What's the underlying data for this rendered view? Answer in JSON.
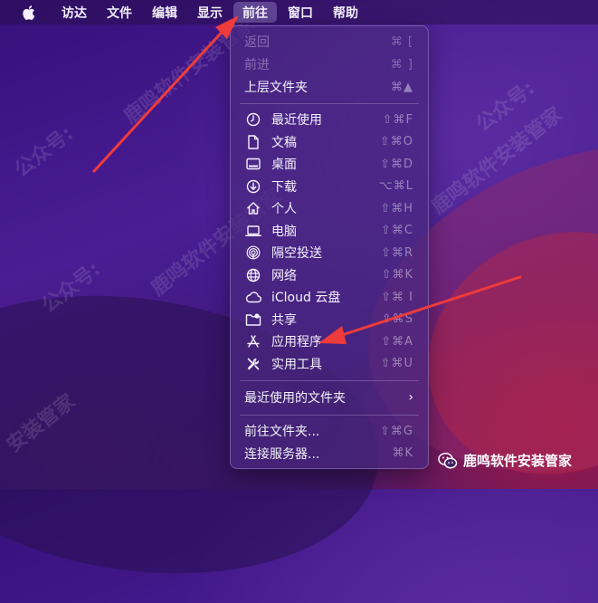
{
  "menubar": {
    "apple_icon": "apple-logo-icon",
    "items": [
      {
        "label": "访达"
      },
      {
        "label": "文件"
      },
      {
        "label": "编辑"
      },
      {
        "label": "显示"
      },
      {
        "label": "前往",
        "active": true
      },
      {
        "label": "窗口"
      },
      {
        "label": "帮助"
      }
    ]
  },
  "go_menu": {
    "top": [
      {
        "label": "返回",
        "shortcut": "⌘ [",
        "enabled": false
      },
      {
        "label": "前进",
        "shortcut": "⌘ ]",
        "enabled": false
      },
      {
        "label": "上层文件夹",
        "shortcut": "⌘▲",
        "enabled": true
      }
    ],
    "places": [
      {
        "label": "最近使用",
        "shortcut": "⇧⌘F",
        "icon": "clock-icon"
      },
      {
        "label": "文稿",
        "shortcut": "⇧⌘O",
        "icon": "document-icon"
      },
      {
        "label": "桌面",
        "shortcut": "⇧⌘D",
        "icon": "desktop-icon"
      },
      {
        "label": "下载",
        "shortcut": "⌥⌘L",
        "icon": "download-icon"
      },
      {
        "label": "个人",
        "shortcut": "⇧⌘H",
        "icon": "home-icon"
      },
      {
        "label": "电脑",
        "shortcut": "⇧⌘C",
        "icon": "laptop-icon"
      },
      {
        "label": "隔空投送",
        "shortcut": "⇧⌘R",
        "icon": "airdrop-icon"
      },
      {
        "label": "网络",
        "shortcut": "⇧⌘K",
        "icon": "globe-icon"
      },
      {
        "label": "iCloud 云盘",
        "shortcut": "⇧⌘ I",
        "icon": "cloud-icon"
      },
      {
        "label": "共享",
        "shortcut": "⇧⌘S",
        "icon": "shared-folder-icon"
      },
      {
        "label": "应用程序",
        "shortcut": "⇧⌘A",
        "icon": "applications-icon"
      },
      {
        "label": "实用工具",
        "shortcut": "⇧⌘U",
        "icon": "tools-icon"
      }
    ],
    "recent_folders": {
      "label": "最近使用的文件夹",
      "chevron": "›"
    },
    "bottom": [
      {
        "label": "前往文件夹...",
        "shortcut": "⇧⌘G"
      },
      {
        "label": "连接服务器...",
        "shortcut": "⌘K"
      }
    ]
  },
  "watermark": {
    "badge_text": "鹿鸣软件安装管家",
    "tiles": [
      "鹿鸣软件安装管家",
      "公众号:",
      "鹿鸣软件安装管家",
      "公众号:",
      "鹿鸣软件安装管家",
      "公众号:",
      "安装管家"
    ]
  },
  "colors": {
    "arrow": "#ee3b3b",
    "menu_bg": "#4a2880",
    "desktop": "#3f1886"
  }
}
